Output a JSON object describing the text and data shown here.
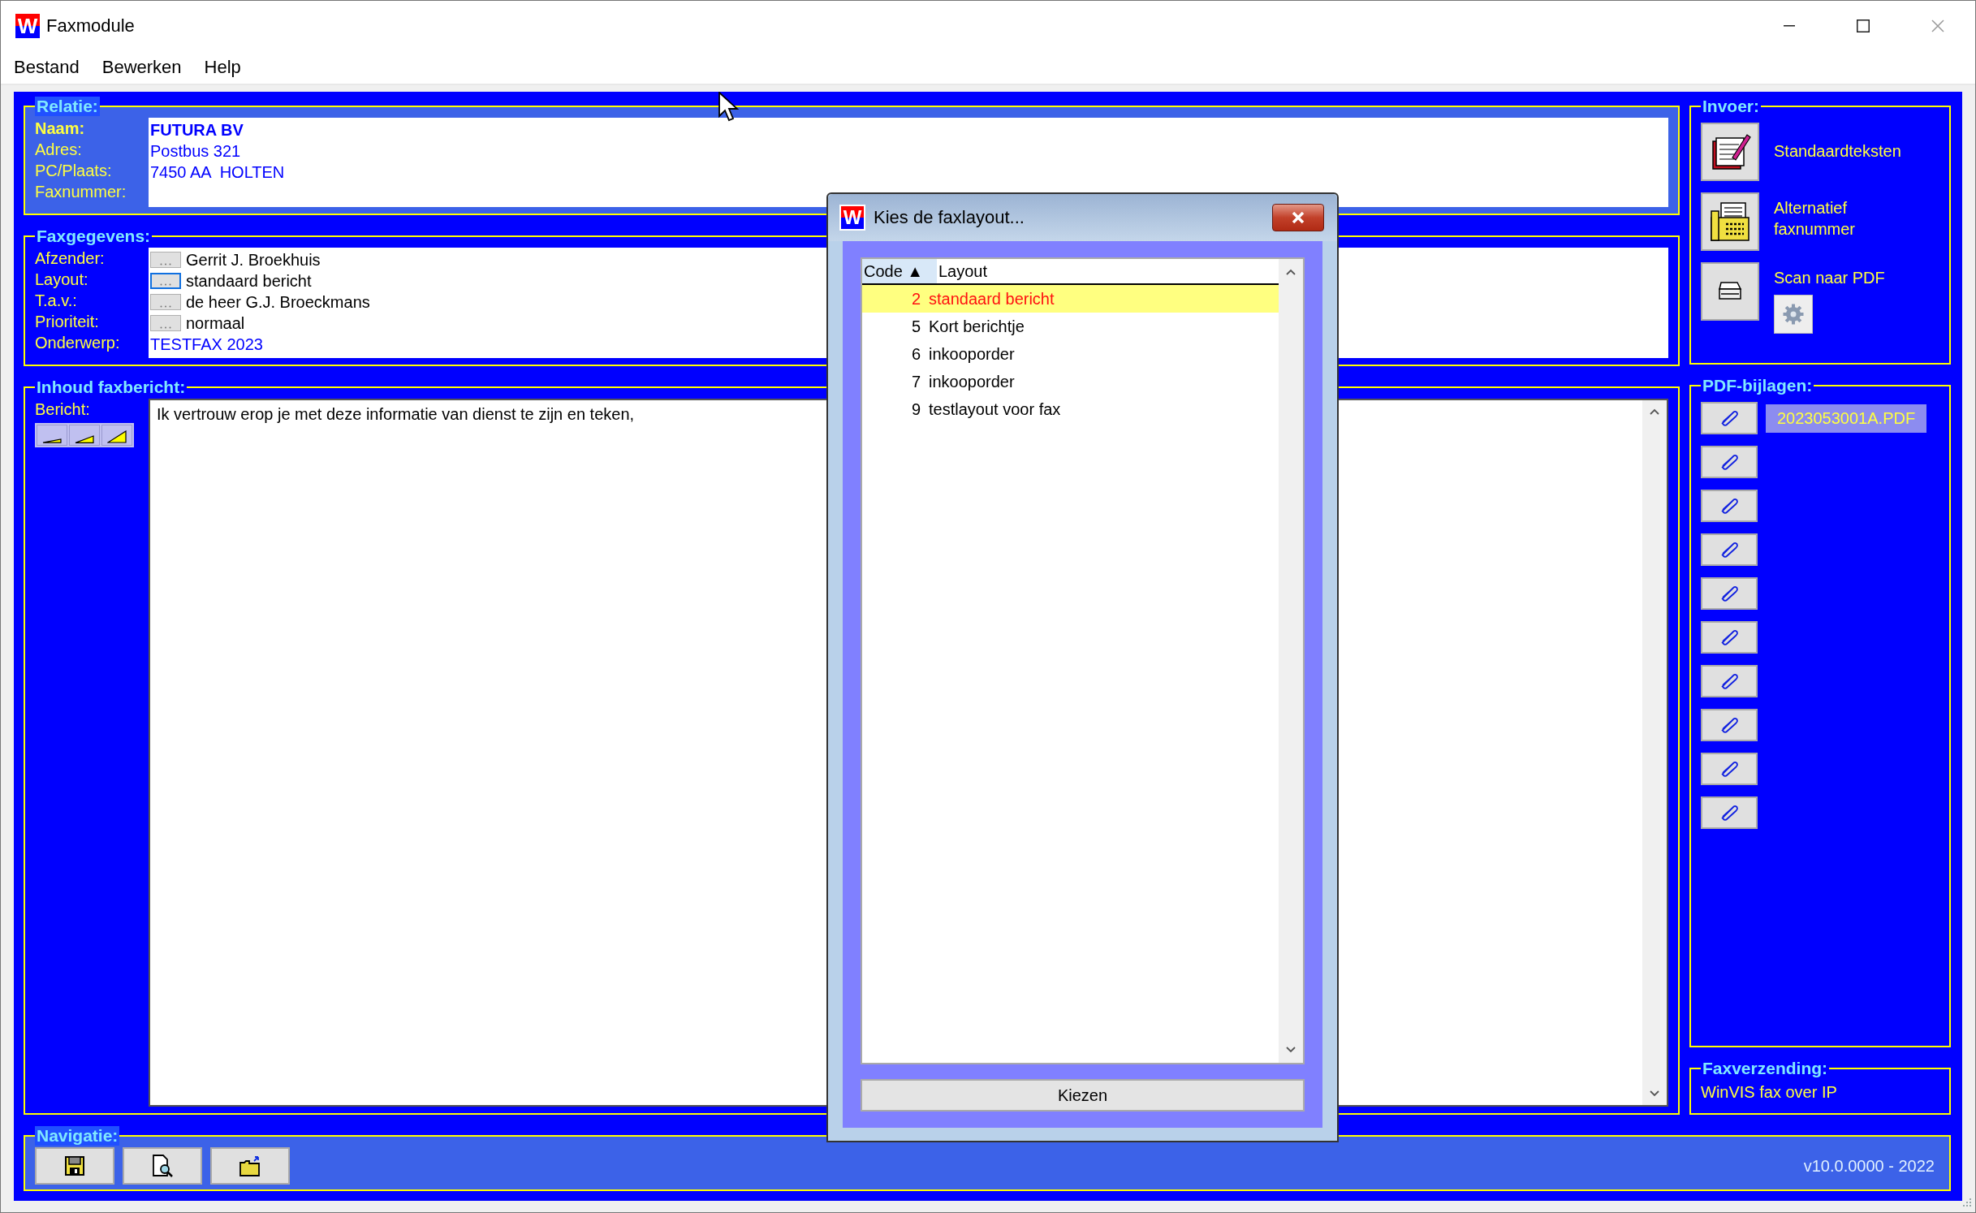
{
  "window": {
    "title": "Faxmodule",
    "logo_letter": "W"
  },
  "menu": [
    {
      "label": "Bestand"
    },
    {
      "label": "Bewerken"
    },
    {
      "label": "Help"
    }
  ],
  "relatie": {
    "title": "Relatie:",
    "fields": [
      {
        "label": "Naam:",
        "value": "FUTURA BV",
        "emphasized": true
      },
      {
        "label": "Adres:",
        "value": "Postbus 321",
        "emphasized": false
      },
      {
        "label": "PC/Plaats:",
        "value": "7450 AA  HOLTEN",
        "emphasized": false
      },
      {
        "label": "Faxnummer:",
        "emphasized": false
      }
    ]
  },
  "faxgegevens": {
    "title": "Faxgegevens:",
    "fields": [
      {
        "kind": "picker",
        "label": "Afzender:",
        "value": "Gerrit J. Broekhuis",
        "focused": false
      },
      {
        "kind": "picker",
        "label": "Layout:",
        "value": "standaard bericht",
        "focused": true
      },
      {
        "kind": "picker",
        "label": "T.a.v.:",
        "value": "de heer G.J. Broeckmans",
        "focused": false
      },
      {
        "kind": "picker",
        "label": "Prioriteit:",
        "value": "normaal",
        "focused": false
      },
      {
        "kind": "text",
        "label": "Onderwerp:",
        "value": "TESTFAX 2023"
      }
    ]
  },
  "inhoud": {
    "title": "Inhoud faxbericht:",
    "label": "Bericht:",
    "message": "Ik vertrouw erop je met deze informatie van dienst te zijn en teken,"
  },
  "navigatie": {
    "title": "Navigatie:",
    "version": "v10.0.0000 - 2022"
  },
  "invoer": {
    "title": "Invoer:",
    "items": [
      {
        "kind": "texts",
        "label": "Standaardteksten"
      },
      {
        "kind": "fax",
        "label": "Alternatief faxnummer"
      },
      {
        "kind": "scan",
        "label": "Scan naar PDF"
      }
    ]
  },
  "pdf_bijlagen": {
    "title": "PDF-bijlagen:",
    "attachments": [
      {
        "file": "2023053001A.PDF"
      }
    ]
  },
  "faxverzending": {
    "title": "Faxverzending:",
    "method": "WinVIS fax over IP"
  },
  "dialog": {
    "title": "Kies de faxlayout...",
    "logo_letter": "W",
    "columns": [
      {
        "label": "Code ▲",
        "sorted": true
      },
      {
        "label": "Layout",
        "sorted": false
      }
    ],
    "rows": [
      {
        "code": "2",
        "layout": "standaard bericht",
        "selected": true
      },
      {
        "code": "5",
        "layout": "Kort berichtje",
        "selected": false
      },
      {
        "code": "6",
        "layout": "inkooporder",
        "selected": false
      },
      {
        "code": "7",
        "layout": "inkooporder",
        "selected": false
      },
      {
        "code": "9",
        "layout": "testlayout voor fax",
        "selected": false
      }
    ],
    "button": "Kiezen"
  }
}
